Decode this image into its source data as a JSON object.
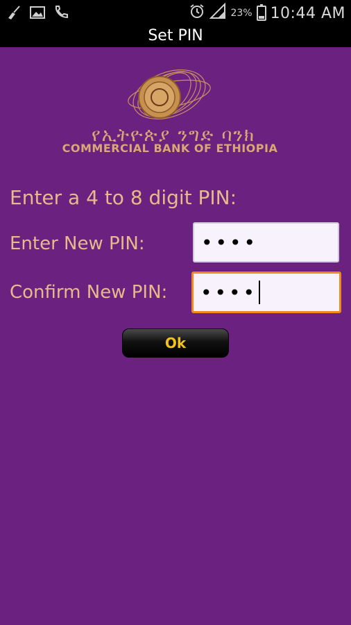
{
  "status_bar": {
    "icons_left": [
      "broom-icon",
      "image-icon",
      "missed-call-icon"
    ],
    "icons_right": [
      "alarm-icon",
      "signal-icon"
    ],
    "battery_percent": "23%",
    "battery_level": 0.23,
    "time": "10:44 AM"
  },
  "titlebar": {
    "title": "Set PIN"
  },
  "logo": {
    "amharic": "የኢትዮጵያ ንግድ ባንክ",
    "english": "COMMERCIAL BANK OF ETHIOPIA",
    "color": "#d9a876"
  },
  "form": {
    "prompt": "Enter a 4 to 8 digit PIN:",
    "new_pin_label": "Enter New PIN:",
    "new_pin_value": "••••",
    "confirm_pin_label": "Confirm New PIN:",
    "confirm_pin_value": "••••",
    "ok_label": "Ok"
  },
  "colors": {
    "background": "#6a2180",
    "label": "#e8b98a",
    "focus": "#f08a1a",
    "button_text": "#f1c21b"
  }
}
